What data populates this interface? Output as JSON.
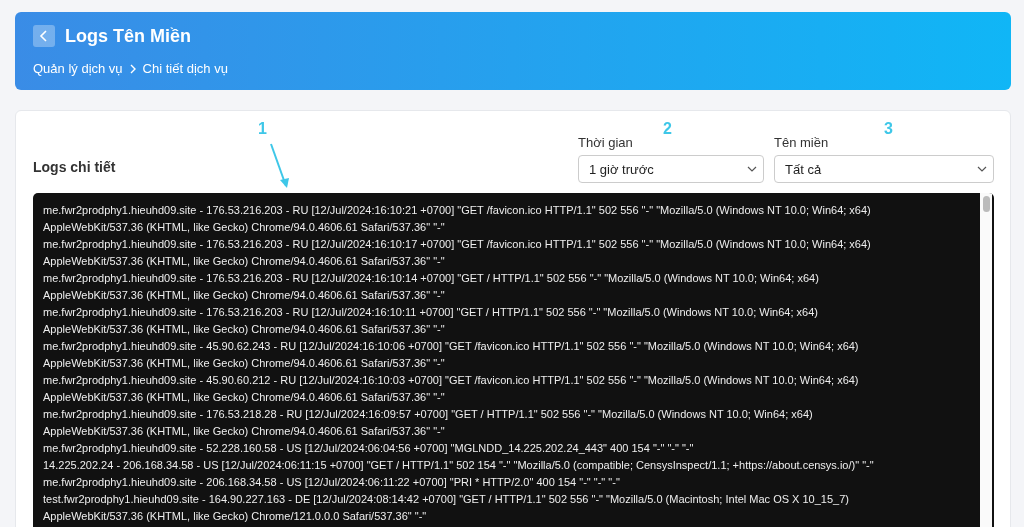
{
  "header": {
    "title": "Logs Tên Miền",
    "breadcrumb": [
      "Quản lý dịch vụ",
      "Chi tiết dịch vụ"
    ]
  },
  "panel": {
    "title": "Logs chi tiết",
    "filters": [
      {
        "label": "Thời gian",
        "value": "1 giờ trước"
      },
      {
        "label": "Tên miền",
        "value": "Tất cả"
      }
    ],
    "log_lines": [
      "me.fwr2prodphy1.hieuhd09.site - 176.53.216.203 - RU [12/Jul/2024:16:10:21 +0700] \"GET /favicon.ico HTTP/1.1\" 502 556 \"-\" \"Mozilla/5.0 (Windows NT 10.0; Win64; x64)",
      "AppleWebKit/537.36 (KHTML, like Gecko) Chrome/94.0.4606.61 Safari/537.36\" \"-\"",
      "me.fwr2prodphy1.hieuhd09.site - 176.53.216.203 - RU [12/Jul/2024:16:10:17 +0700] \"GET /favicon.ico HTTP/1.1\" 502 556 \"-\" \"Mozilla/5.0 (Windows NT 10.0; Win64; x64)",
      "AppleWebKit/537.36 (KHTML, like Gecko) Chrome/94.0.4606.61 Safari/537.36\" \"-\"",
      "me.fwr2prodphy1.hieuhd09.site - 176.53.216.203 - RU [12/Jul/2024:16:10:14 +0700] \"GET / HTTP/1.1\" 502 556 \"-\" \"Mozilla/5.0 (Windows NT 10.0; Win64; x64)",
      "AppleWebKit/537.36 (KHTML, like Gecko) Chrome/94.0.4606.61 Safari/537.36\" \"-\"",
      "me.fwr2prodphy1.hieuhd09.site - 176.53.216.203 - RU [12/Jul/2024:16:10:11 +0700] \"GET / HTTP/1.1\" 502 556 \"-\" \"Mozilla/5.0 (Windows NT 10.0; Win64; x64)",
      "AppleWebKit/537.36 (KHTML, like Gecko) Chrome/94.0.4606.61 Safari/537.36\" \"-\"",
      "me.fwr2prodphy1.hieuhd09.site - 45.90.62.243 - RU [12/Jul/2024:16:10:06 +0700] \"GET /favicon.ico HTTP/1.1\" 502 556 \"-\" \"Mozilla/5.0 (Windows NT 10.0; Win64; x64)",
      "AppleWebKit/537.36 (KHTML, like Gecko) Chrome/94.0.4606.61 Safari/537.36\" \"-\"",
      "me.fwr2prodphy1.hieuhd09.site - 45.90.60.212 - RU [12/Jul/2024:16:10:03 +0700] \"GET /favicon.ico HTTP/1.1\" 502 556 \"-\" \"Mozilla/5.0 (Windows NT 10.0; Win64; x64)",
      "AppleWebKit/537.36 (KHTML, like Gecko) Chrome/94.0.4606.61 Safari/537.36\" \"-\"",
      "me.fwr2prodphy1.hieuhd09.site - 176.53.218.28 - RU [12/Jul/2024:16:09:57 +0700] \"GET / HTTP/1.1\" 502 556 \"-\" \"Mozilla/5.0 (Windows NT 10.0; Win64; x64)",
      "AppleWebKit/537.36 (KHTML, like Gecko) Chrome/94.0.4606.61 Safari/537.36\" \"-\"",
      "me.fwr2prodphy1.hieuhd09.site - 52.228.160.58 - US [12/Jul/2024:06:04:56 +0700] \"MGLNDD_14.225.202.24_443\" 400 154 \"-\" \"-\" \"-\"",
      "14.225.202.24 - 206.168.34.58 - US [12/Jul/2024:06:11:15 +0700] \"GET / HTTP/1.1\" 502 154 \"-\" \"Mozilla/5.0 (compatible; CensysInspect/1.1; +https://about.censys.io/)\" \"-\"",
      "me.fwr2prodphy1.hieuhd09.site - 206.168.34.58 - US [12/Jul/2024:06:11:22 +0700] \"PRI * HTTP/2.0\" 400 154 \"-\" \"-\" \"-\"",
      "test.fwr2prodphy1.hieuhd09.site - 164.90.227.163 - DE [12/Jul/2024:08:14:42 +0700] \"GET / HTTP/1.1\" 502 556 \"-\" \"Mozilla/5.0 (Macintosh; Intel Mac OS X 10_15_7)",
      "AppleWebKit/537.36 (KHTML, like Gecko) Chrome/121.0.0.0 Safari/537.36\" \"-\""
    ]
  },
  "annotations": [
    {
      "label": "1",
      "kind": "arrow"
    },
    {
      "label": "2",
      "kind": "number"
    },
    {
      "label": "3",
      "kind": "number"
    }
  ]
}
